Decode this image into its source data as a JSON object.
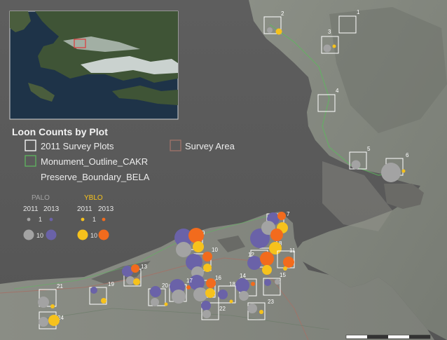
{
  "legend": {
    "title": "Loon Counts by Plot",
    "items": [
      {
        "label": "2011 Survey Plots"
      },
      {
        "label": "Survey Area"
      },
      {
        "label": "Monument_Outline_CAKR"
      },
      {
        "label": "Preserve_Boundary_BELA"
      }
    ],
    "palo": {
      "label": "PALO",
      "year_a": "2011",
      "year_b": "2013",
      "small": "1",
      "large": "10"
    },
    "yblo": {
      "label": "YBLO",
      "year_a": "2011",
      "year_b": "2013",
      "small": "1",
      "large": "10"
    }
  },
  "colors": {
    "palo_2011": "#a3a3a3",
    "palo_2013": "#6a62a8",
    "yblo_2011": "#f6c21c",
    "yblo_2013": "#f26b1d",
    "plot_outline": "#ffffff",
    "monument_outline": "#5fb55f",
    "survey_area": "#a0746a"
  },
  "plots": [
    {
      "label": "1"
    },
    {
      "label": "2"
    },
    {
      "label": "3"
    },
    {
      "label": "4"
    },
    {
      "label": "5"
    },
    {
      "label": "6"
    },
    {
      "label": "7"
    },
    {
      "label": "8"
    },
    {
      "label": "9"
    },
    {
      "label": "10"
    },
    {
      "label": "11"
    },
    {
      "label": "12"
    },
    {
      "label": "13"
    },
    {
      "label": "14"
    },
    {
      "label": "15"
    },
    {
      "label": "16"
    },
    {
      "label": "17"
    },
    {
      "label": "18"
    },
    {
      "label": "19"
    },
    {
      "label": "20"
    },
    {
      "label": "21"
    },
    {
      "label": "22"
    },
    {
      "label": "23"
    },
    {
      "label": "24"
    }
  ]
}
